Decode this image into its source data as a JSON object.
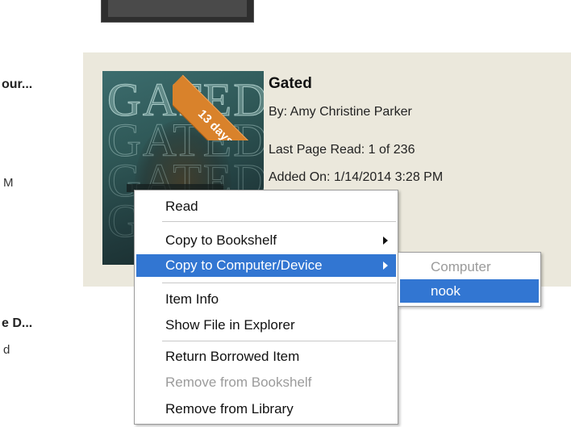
{
  "left_column": {
    "item1_title": "our...",
    "item1_meta": "M",
    "item2_title": "e D...",
    "item2_meta": "d"
  },
  "book": {
    "badge": "13 days",
    "cover_text": "GATED",
    "title": "Gated",
    "author_line": "By:  Amy Christine Parker",
    "last_page_line": "Last Page Read:  1 of 236",
    "added_line": "Added On:  1/14/2014 3:28 PM"
  },
  "context_menu": {
    "items": [
      {
        "label": "Read",
        "enabled": true
      },
      {
        "label": "Copy to Bookshelf",
        "enabled": true,
        "submenu": true
      },
      {
        "label": "Copy to Computer/Device",
        "enabled": true,
        "submenu": true,
        "highlighted": true
      },
      {
        "label": "Item Info",
        "enabled": true
      },
      {
        "label": "Show File in Explorer",
        "enabled": true
      },
      {
        "label": "Return Borrowed Item",
        "enabled": true
      },
      {
        "label": "Remove from Bookshelf",
        "enabled": false
      },
      {
        "label": "Remove from Library",
        "enabled": true
      }
    ]
  },
  "submenu": {
    "items": [
      {
        "label": "Computer",
        "enabled": false
      },
      {
        "label": "nook",
        "enabled": true,
        "highlighted": true
      }
    ]
  },
  "colors": {
    "card_background": "#ebe8dc",
    "highlight": "#3276d2",
    "badge": "#d9822b",
    "disabled_text": "#9b9b9b"
  }
}
